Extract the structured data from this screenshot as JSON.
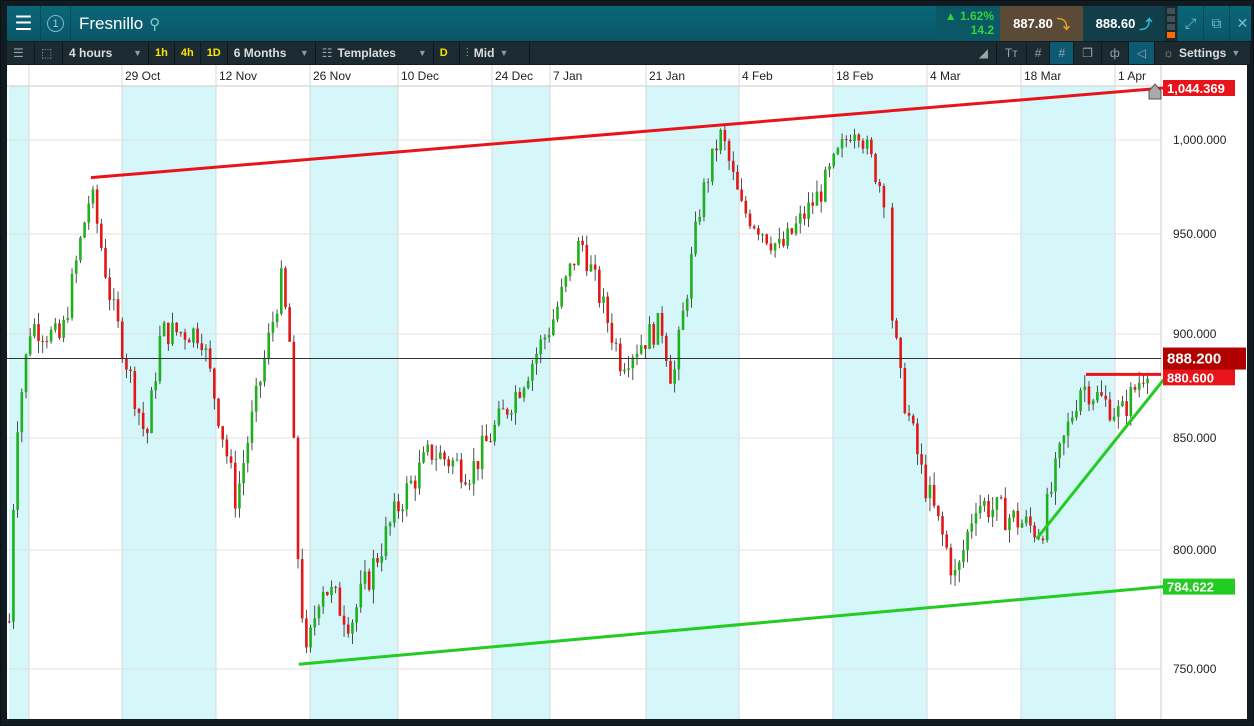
{
  "titlebar": {
    "instrument_number": "1",
    "title": "Fresnillo",
    "change_pct": "▲ 1.62%",
    "change_abs": "14.2",
    "sell_price": "887.80",
    "buy_price": "888.60"
  },
  "toolbar": {
    "interval": "4 hours",
    "quick_intervals": [
      "1h",
      "4h",
      "1D"
    ],
    "range": "6 Months",
    "templates": "Templates",
    "d_label": "D",
    "price_type": "Mid",
    "settings": "Settings"
  },
  "chart_data": {
    "type": "candlestick",
    "instrument": "Fresnillo",
    "x_tick_labels": [
      "29 Oct",
      "12 Nov",
      "26 Nov",
      "10 Dec",
      "24 Dec",
      "7 Jan",
      "21 Jan",
      "4 Feb",
      "18 Feb",
      "4 Mar",
      "18 Mar",
      "1 Apr"
    ],
    "y_tick_labels": [
      "1,000.000",
      "950.000",
      "900.000",
      "850.000",
      "800.000",
      "750.000"
    ],
    "y_ticks": [
      1000,
      950,
      900,
      850,
      800,
      750
    ],
    "price_path_days_from_29_Oct": [
      [
        -17,
        770
      ],
      [
        -16,
        853
      ],
      [
        -13.8,
        905
      ],
      [
        -9.3,
        897
      ],
      [
        -4.9,
        973
      ],
      [
        -1.9,
        916
      ],
      [
        3.3,
        849
      ],
      [
        5.5,
        901
      ],
      [
        11.4,
        901
      ],
      [
        16.6,
        822
      ],
      [
        23.3,
        926
      ],
      [
        24.7,
        892
      ],
      [
        25.5,
        808
      ],
      [
        27,
        753
      ],
      [
        29.2,
        787
      ],
      [
        33.6,
        770
      ],
      [
        41,
        822
      ],
      [
        45.5,
        844
      ],
      [
        51.4,
        835
      ],
      [
        58.8,
        876
      ],
      [
        63.3,
        905
      ],
      [
        67.7,
        947
      ],
      [
        73.6,
        887
      ],
      [
        79.6,
        905
      ],
      [
        81.3,
        876
      ],
      [
        85.5,
        968
      ],
      [
        88.4,
        1005
      ],
      [
        91.4,
        964
      ],
      [
        97.3,
        942
      ],
      [
        103.3,
        973
      ],
      [
        108.4,
        1011
      ],
      [
        112.9,
        968
      ],
      [
        113.3,
        922
      ],
      [
        115.1,
        876
      ],
      [
        118.1,
        835
      ],
      [
        123.3,
        787
      ],
      [
        126.2,
        822
      ],
      [
        135.9,
        808
      ],
      [
        138.8,
        844
      ],
      [
        141.8,
        876
      ],
      [
        147.7,
        861
      ],
      [
        152.1,
        888
      ]
    ],
    "current_price": {
      "value": 888.2,
      "label": "888.200"
    },
    "horizontal_line": {
      "value": 880.6,
      "label": "880.600"
    },
    "trendlines": [
      {
        "name": "upper-resistance",
        "color": "#e8141c",
        "from": [
          -4.9,
          980
        ],
        "to": [
          154,
          1044.369
        ],
        "label": "1,044.369"
      },
      {
        "name": "lower-support",
        "color": "#22cc22",
        "from": [
          25.9,
          752
        ],
        "to": [
          154,
          784.622
        ],
        "label": "784.622"
      },
      {
        "name": "short-uptrend",
        "color": "#22cc22",
        "from": [
          135.2,
          805
        ],
        "to": [
          154,
          878
        ]
      }
    ]
  },
  "colors": {
    "up": "#1fb01f",
    "down": "#e01818",
    "band": "#d5f7fa"
  }
}
